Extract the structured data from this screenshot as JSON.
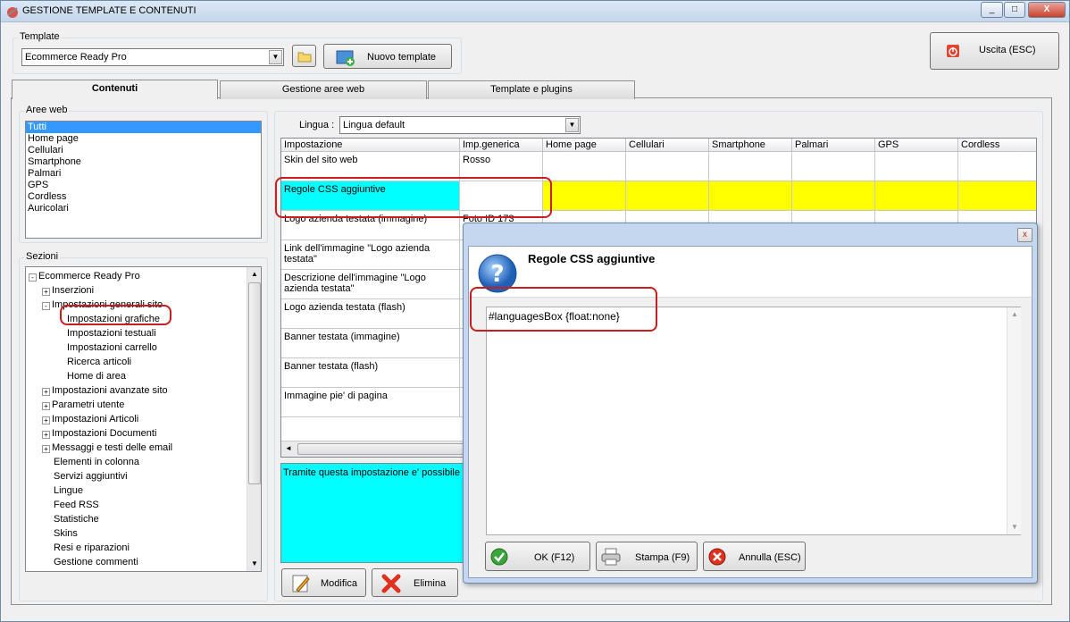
{
  "window": {
    "title": "GESTIONE TEMPLATE E CONTENUTI",
    "min": "_",
    "max": "□",
    "close": "X"
  },
  "template": {
    "group_label": "Template",
    "selected": "Ecommerce Ready Pro",
    "new_button": "Nuovo template",
    "exit_button": "Uscita (ESC)"
  },
  "tabs": [
    "Contenuti",
    "Gestione aree web",
    "Template e plugins"
  ],
  "aree_web": {
    "label": "Aree web",
    "items": [
      "Tutti",
      "Home page",
      "Cellulari",
      "Smartphone",
      "Palmari",
      "GPS",
      "Cordless",
      "Auricolari"
    ]
  },
  "sezioni": {
    "label": "Sezioni",
    "items": [
      {
        "text": "Ecommerce Ready Pro",
        "level": 0,
        "pm": "-"
      },
      {
        "text": "Inserzioni",
        "level": 1,
        "pm": "+"
      },
      {
        "text": "Impostazioni generali sito",
        "level": 1,
        "pm": "-"
      },
      {
        "text": "Impostazioni grafiche",
        "level": 2,
        "pm": ""
      },
      {
        "text": "Impostazioni testuali",
        "level": 2,
        "pm": ""
      },
      {
        "text": "Impostazioni carrello",
        "level": 2,
        "pm": ""
      },
      {
        "text": "Ricerca articoli",
        "level": 2,
        "pm": ""
      },
      {
        "text": "Home di area",
        "level": 2,
        "pm": ""
      },
      {
        "text": "Impostazioni avanzate sito",
        "level": 1,
        "pm": "+"
      },
      {
        "text": "Parametri utente",
        "level": 1,
        "pm": "+"
      },
      {
        "text": "Impostazioni Articoli",
        "level": 1,
        "pm": "+"
      },
      {
        "text": "Impostazioni Documenti",
        "level": 1,
        "pm": "+"
      },
      {
        "text": "Messaggi e testi delle email",
        "level": 1,
        "pm": "+"
      },
      {
        "text": "Elementi in colonna",
        "level": 1,
        "pm": ""
      },
      {
        "text": "Servizi aggiuntivi",
        "level": 1,
        "pm": ""
      },
      {
        "text": "Lingue",
        "level": 1,
        "pm": ""
      },
      {
        "text": "Feed RSS",
        "level": 1,
        "pm": ""
      },
      {
        "text": "Statistiche",
        "level": 1,
        "pm": ""
      },
      {
        "text": "Skins",
        "level": 1,
        "pm": ""
      },
      {
        "text": "Resi e riparazioni",
        "level": 1,
        "pm": ""
      },
      {
        "text": "Gestione commenti",
        "level": 1,
        "pm": ""
      }
    ]
  },
  "lingua": {
    "label": "Lingua :",
    "selected": "Lingua default"
  },
  "grid": {
    "columns": [
      "Impostazione",
      "Imp.generica",
      "Home page",
      "Cellulari",
      "Smartphone",
      "Palmari",
      "GPS",
      "Cordless"
    ],
    "rows": [
      {
        "name": "Skin del sito web",
        "value": "Rosso"
      },
      {
        "name": "Regole CSS aggiuntive",
        "value": ""
      },
      {
        "name": "Logo azienda testata (immagine)",
        "value": "Foto ID 173"
      },
      {
        "name": "Link dell'immagine \"Logo azienda testata\"",
        "value": ""
      },
      {
        "name": "Descrizione dell'immagine \"Logo azienda testata\"",
        "value": ""
      },
      {
        "name": "Logo azienda testata (flash)",
        "value": ""
      },
      {
        "name": "Banner testata (immagine)",
        "value": ""
      },
      {
        "name": "Banner testata (flash)",
        "value": ""
      },
      {
        "name": "Immagine pie' di pagina",
        "value": ""
      }
    ]
  },
  "description": "Tramite questa impostazione e' possibile s",
  "bottom_buttons": {
    "modifica": "Modifica",
    "elimina": "Elimina"
  },
  "dialog": {
    "title": "Regole CSS aggiuntive",
    "content": "#languagesBox {float:none}",
    "ok": "OK (F12)",
    "stampa": "Stampa (F9)",
    "annulla": "Annulla (ESC)",
    "close": "x"
  },
  "colors": {
    "highlight_cyan": "#00ffff",
    "highlight_yellow": "#ffff00",
    "selection": "#3399ff",
    "annotation_red": "#c81e1e"
  }
}
